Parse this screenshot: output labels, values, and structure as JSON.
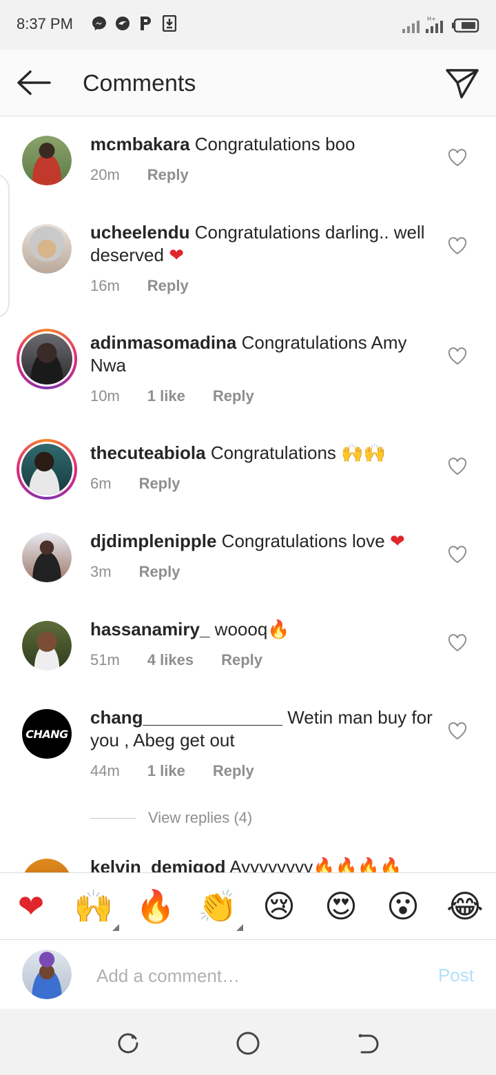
{
  "status_bar": {
    "time": "8:37 PM",
    "left_icons": [
      "messenger-icon",
      "hummingbird-icon",
      "p-icon",
      "download-icon"
    ],
    "right_icons": [
      "signal-icon",
      "signal-h-plus-icon",
      "battery-icon"
    ]
  },
  "header": {
    "title": "Comments",
    "back_icon": "arrow-left-icon",
    "share_icon": "paper-plane-icon"
  },
  "comments": [
    {
      "username": "mcmbakara",
      "text": " Congratulations boo",
      "time": "20m",
      "likes": "",
      "reply": "Reply",
      "story_ring": false,
      "avatar_color": "#c0392b"
    },
    {
      "username": "ucheelendu",
      "text": " Congratulations darling.. well deserved ❤",
      "time": "16m",
      "likes": "",
      "reply": "Reply",
      "story_ring": false,
      "avatar_color": "#d8b48a"
    },
    {
      "username": "adinmasomadina",
      "text": " Congratulations Amy Nwa",
      "time": "10m",
      "likes": "1 like",
      "reply": "Reply",
      "story_ring": true,
      "avatar_color": "#3a2a28"
    },
    {
      "username": "thecuteabiola",
      "text": " Congratulations 🙌🙌",
      "time": "6m",
      "likes": "",
      "reply": "Reply",
      "story_ring": true,
      "avatar_color": "#1f4a4f"
    },
    {
      "username": "djdimplenipple",
      "text": " Congratulations love ❤",
      "time": "3m",
      "likes": "",
      "reply": "Reply",
      "story_ring": false,
      "avatar_color": "#6b4a3d"
    },
    {
      "username": "hassanamiry_",
      "text": " woooq🔥",
      "time": "51m",
      "likes": "4 likes",
      "reply": "Reply",
      "story_ring": false,
      "avatar_color": "#4a5a32"
    },
    {
      "username": "chang______________",
      "text": " Wetin man buy for you , Abeg get out",
      "time": "44m",
      "likes": "1 like",
      "reply": "Reply",
      "story_ring": false,
      "avatar_color": "#000000",
      "avatar_text": "CHANG"
    },
    {
      "username": "kelvin_demigod",
      "text": " Ayyyyyyyy🔥🔥🔥🔥",
      "time": "",
      "likes": "",
      "reply": "",
      "story_ring": false,
      "avatar_color": "#e08a1e"
    }
  ],
  "view_replies": "View replies (4)",
  "emoji_bar": [
    "❤",
    "🙌",
    "🔥",
    "👏",
    "😢",
    "😍",
    "😮",
    "😂"
  ],
  "add_comment": {
    "placeholder": "Add a comment…",
    "post_label": "Post"
  },
  "nav_bar": [
    "recent-apps-icon",
    "home-icon",
    "back-icon"
  ],
  "colors": {
    "accent_disabled": "#b2dffc",
    "secondary_text": "#8e8e8e",
    "heart_red": "#ed4956"
  }
}
